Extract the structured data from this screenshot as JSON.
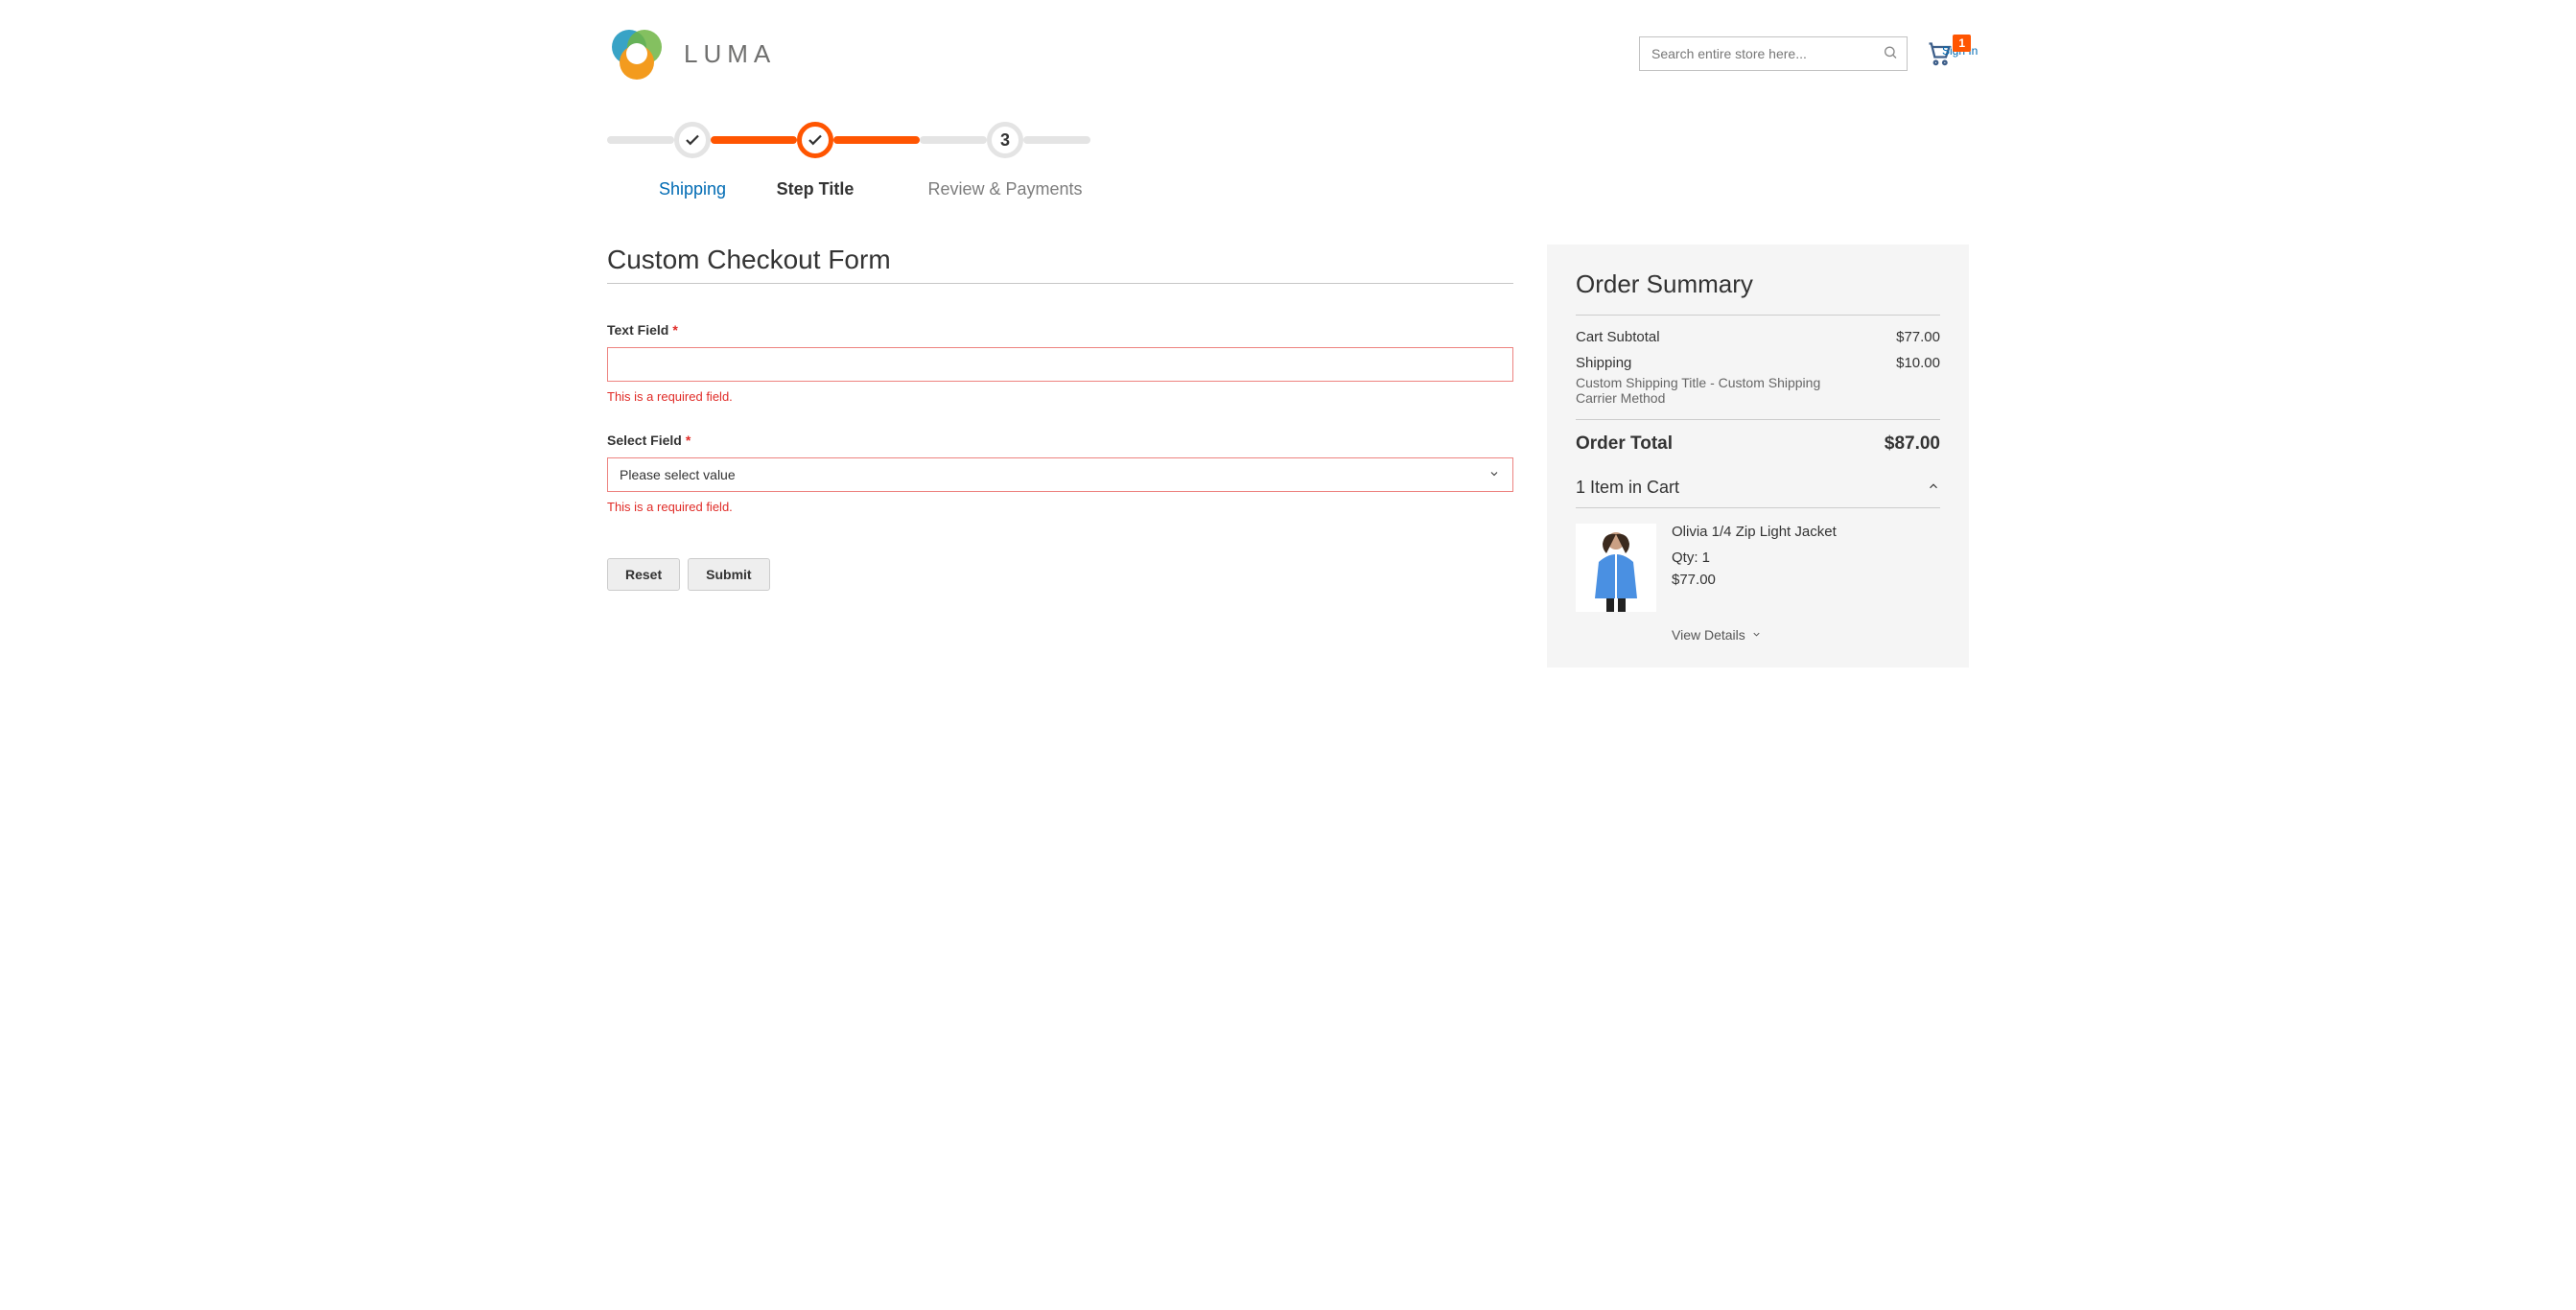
{
  "header": {
    "brand": "LUMA",
    "search_placeholder": "Search entire store here...",
    "cart_count": "1",
    "sign_in": "Sign In"
  },
  "progress": {
    "step1_label": "Shipping",
    "step2_label": "Step Title",
    "step3_label": "Review & Payments",
    "step3_number": "3"
  },
  "form": {
    "title": "Custom Checkout Form",
    "field1_label": "Text Field",
    "field1_error": "This is a required field.",
    "field2_label": "Select Field",
    "field2_selected": "Please select value",
    "field2_error": "This is a required field.",
    "reset_label": "Reset",
    "submit_label": "Submit"
  },
  "summary": {
    "title": "Order Summary",
    "subtotal_label": "Cart Subtotal",
    "subtotal_value": "$77.00",
    "shipping_label": "Shipping",
    "shipping_value": "$10.00",
    "shipping_method": "Custom Shipping Title - Custom Shipping Carrier Method",
    "total_label": "Order Total",
    "total_value": "$87.00",
    "items_title": "1 Item in Cart",
    "product_name": "Olivia 1/4 Zip Light Jacket",
    "product_qty": "Qty: 1",
    "product_price": "$77.00",
    "view_details": "View Details"
  }
}
